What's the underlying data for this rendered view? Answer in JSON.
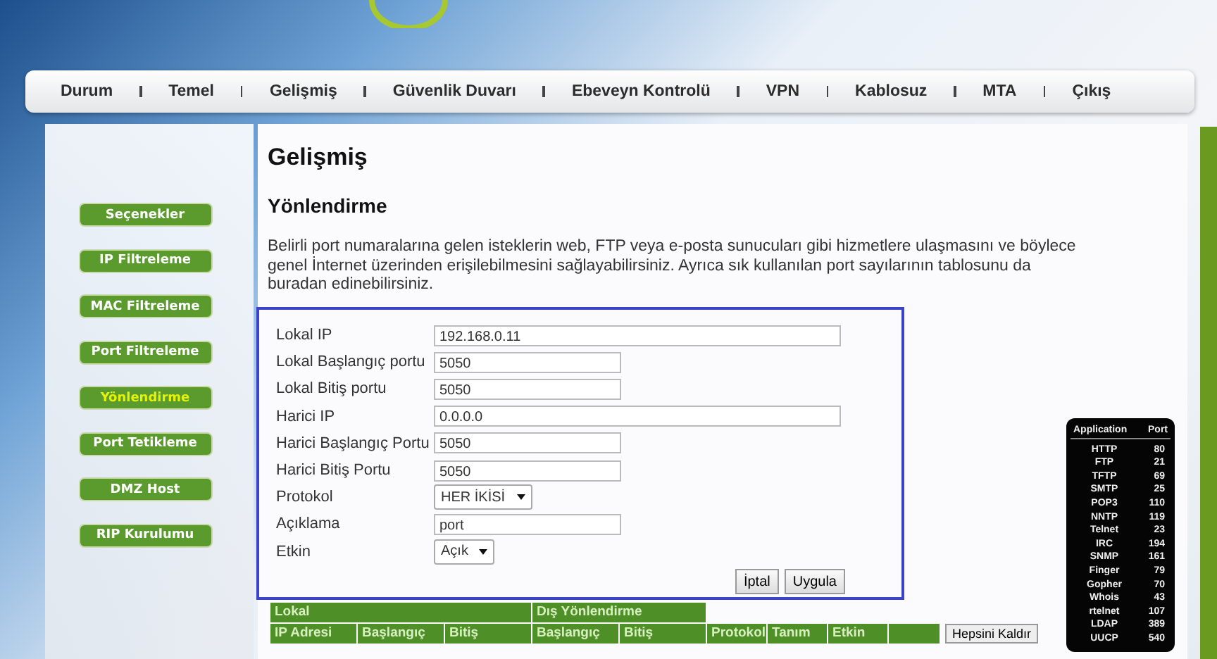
{
  "nav": [
    "Durum",
    "Temel",
    "Gelişmiş",
    "Güvenlik Duvarı",
    "Ebeveyn Kontrolü",
    "VPN",
    "Kablosuz",
    "MTA",
    "Çıkış"
  ],
  "sidebar": {
    "items": [
      {
        "label": "Seçenekler",
        "selected": false
      },
      {
        "label": "IP Filtreleme",
        "selected": false
      },
      {
        "label": "MAC Filtreleme",
        "selected": false
      },
      {
        "label": "Port Filtreleme",
        "selected": false
      },
      {
        "label": "Yönlendirme",
        "selected": true
      },
      {
        "label": "Port Tetikleme",
        "selected": false
      },
      {
        "label": "DMZ Host",
        "selected": false
      },
      {
        "label": "RIP Kurulumu",
        "selected": false
      }
    ]
  },
  "page_title": "Gelişmiş",
  "section_title": "Yönlendirme",
  "description": "Belirli port numaralarına gelen isteklerin web, FTP veya e-posta sunucuları gibi hizmetlere ulaşmasını ve böylece genel İnternet üzerinden erişilebilmesini sağlayabilirsiniz. Ayrıca sık kullanılan port sayılarının tablosunu da buradan edinebilirsiniz.",
  "form": {
    "fields": [
      {
        "kind": "address",
        "label": "Lokal IP",
        "value": "192.168.0.11"
      },
      {
        "kind": "port",
        "label": "Lokal Başlangıç portu",
        "value": "5050"
      },
      {
        "kind": "port",
        "label": "Lokal Bitiş portu",
        "value": "5050"
      },
      {
        "kind": "address",
        "label": "Harici IP",
        "value": "0.0.0.0"
      },
      {
        "kind": "port",
        "label": "Harici Başlangıç Portu",
        "value": "5050"
      },
      {
        "kind": "port",
        "label": "Harici Bitiş Portu",
        "value": "5050"
      },
      {
        "kind": "select",
        "label": "Protokol",
        "value": "HER İKİSİ"
      },
      {
        "kind": "port",
        "label": "Açıklama",
        "value": "port"
      },
      {
        "kind": "select",
        "label": "Etkin",
        "value": "Açık"
      }
    ],
    "buttons": [
      "İptal",
      "Uygula"
    ]
  },
  "rules_table": {
    "groups": [
      "Lokal",
      "Dış Yönlendirme"
    ],
    "columns": [
      "IP Adresi",
      "Başlangıç",
      "Bitiş",
      "Başlangıç",
      "Bitiş",
      "Protokol",
      "Tanım",
      "Etkin"
    ],
    "remove_all_button": "Hepsini Kaldır"
  },
  "port_reference": {
    "columns": [
      "Application",
      "Port"
    ],
    "rows": [
      [
        "HTTP",
        "80"
      ],
      [
        "FTP",
        "21"
      ],
      [
        "TFTP",
        "69"
      ],
      [
        "SMTP",
        "25"
      ],
      [
        "POP3",
        "110"
      ],
      [
        "NNTP",
        "119"
      ],
      [
        "Telnet",
        "23"
      ],
      [
        "IRC",
        "194"
      ],
      [
        "SNMP",
        "161"
      ],
      [
        "Finger",
        "79"
      ],
      [
        "Gopher",
        "70"
      ],
      [
        "Whois",
        "43"
      ],
      [
        "rtelnet",
        "107"
      ],
      [
        "LDAP",
        "389"
      ],
      [
        "UUCP",
        "540"
      ]
    ]
  }
}
